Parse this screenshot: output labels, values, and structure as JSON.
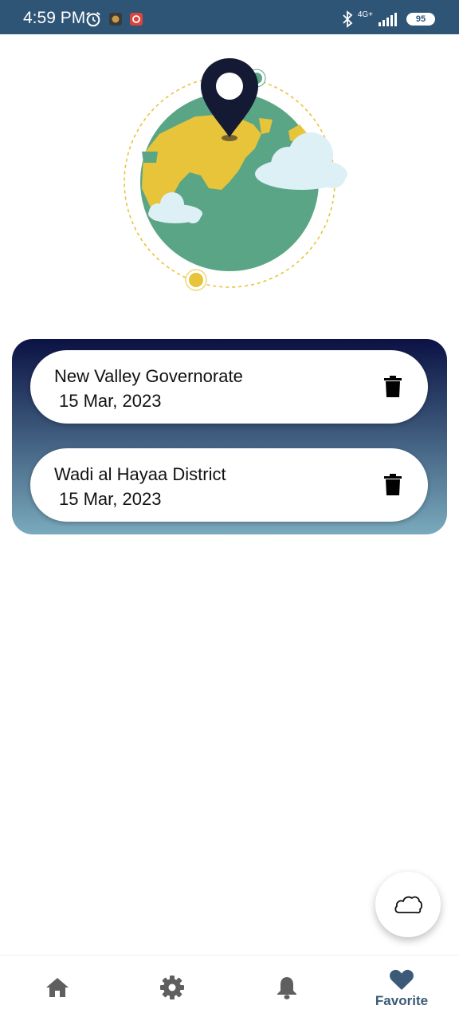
{
  "status_bar": {
    "time": "4:59 PM",
    "network_label": "4G+",
    "battery_level": "95"
  },
  "favorites": [
    {
      "name": "New Valley Governorate",
      "date": " 15 Mar, 2023"
    },
    {
      "name": "Wadi al Hayaa District",
      "date": " 15 Mar, 2023"
    }
  ],
  "fab": {
    "icon": "cloud-icon"
  },
  "bottom_nav": {
    "items": [
      {
        "id": "home",
        "icon": "home-icon",
        "label": ""
      },
      {
        "id": "settings",
        "icon": "gear-icon",
        "label": ""
      },
      {
        "id": "notifications",
        "icon": "bell-icon",
        "label": ""
      },
      {
        "id": "favorite",
        "icon": "heart-icon",
        "label": "Favorite"
      }
    ],
    "active": "favorite"
  },
  "colors": {
    "status_bar": "#2f5576",
    "panel_top": "#0b1244",
    "panel_bottom": "#7aaabd",
    "active_nav": "#3c5a78",
    "inactive_nav": "#5f5f5f"
  }
}
